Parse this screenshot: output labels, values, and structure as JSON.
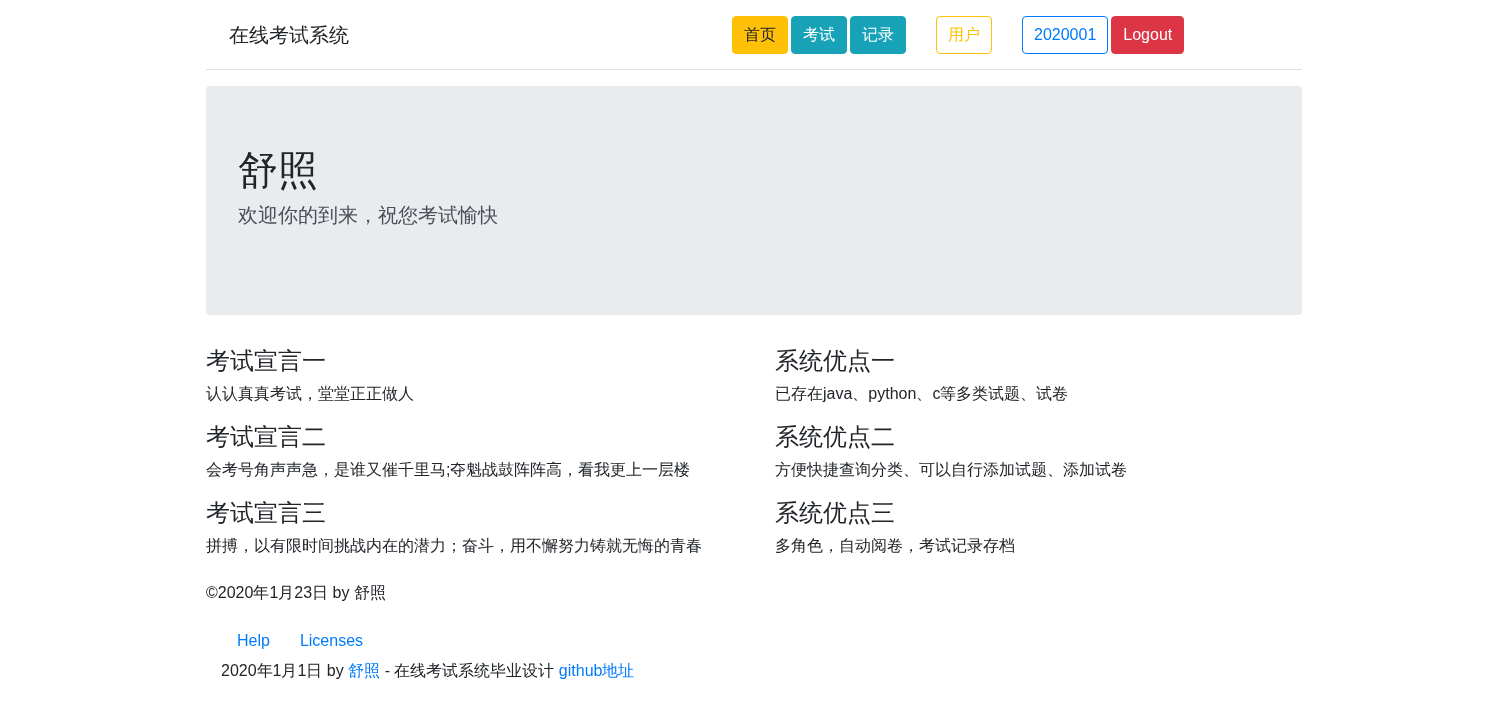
{
  "navbar": {
    "brand": "在线考试系统",
    "button_groups": [
      [
        {
          "label": "首页",
          "kind": "warning"
        },
        {
          "label": "考试",
          "kind": "info"
        },
        {
          "label": "记录",
          "kind": "info"
        }
      ],
      [
        {
          "label": "用户",
          "kind": "outline-warning"
        }
      ],
      [
        {
          "label": "2020001",
          "kind": "outline-primary"
        },
        {
          "label": "Logout",
          "kind": "danger"
        }
      ]
    ]
  },
  "jumbotron": {
    "title": "舒照",
    "subtitle": "欢迎你的到来，祝您考试愉快"
  },
  "columns": [
    [
      {
        "heading": "考试宣言一",
        "text": "认认真真考试，堂堂正正做人"
      },
      {
        "heading": "考试宣言二",
        "text": "会考号角声声急，是谁又催千里马;夺魁战鼓阵阵高，看我更上一层楼"
      },
      {
        "heading": "考试宣言三",
        "text": "拼搏，以有限时间挑战内在的潜力；奋斗，用不懈努力铸就无悔的青春"
      }
    ],
    [
      {
        "heading": "系统优点一",
        "text": "已存在java、python、c等多类试题、试卷"
      },
      {
        "heading": "系统优点二",
        "text": "方便快捷查询分类、可以自行添加试题、添加试卷"
      },
      {
        "heading": "系统优点三",
        "text": "多角色，自动阅卷，考试记录存档"
      }
    ]
  ],
  "copyright": "©2020年1月23日 by 舒照",
  "footer": {
    "links": [
      "Help",
      "Licenses"
    ],
    "line": [
      {
        "kind": "text",
        "text": "2020年1月1日 by "
      },
      {
        "kind": "link",
        "text": "舒照"
      },
      {
        "kind": "text",
        "text": " - 在线考试系统毕业设计 "
      },
      {
        "kind": "link",
        "text": "github地址"
      }
    ]
  }
}
